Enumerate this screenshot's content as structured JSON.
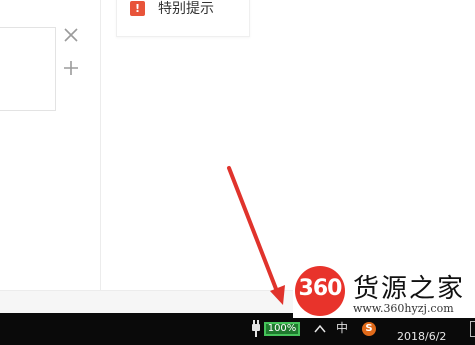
{
  "notice": {
    "badge": "!",
    "label": "特别提示",
    "badge_color": "#e8543a"
  },
  "panel": {
    "close_icon": "close-icon",
    "add_icon": "plus-icon"
  },
  "taskbar": {
    "battery_percent": "100%",
    "ime_label": "中",
    "sogou_label": "S",
    "date": "2018/6/2",
    "icons": [
      "power-plug-icon",
      "battery-icon",
      "chevron-up-icon",
      "ime-icon",
      "sogou-icon",
      "notification-icon"
    ]
  },
  "watermark": {
    "logo_text": "360",
    "title": "货源之家",
    "url": "www.360hyzj.com",
    "logo_color": "#e8332b"
  },
  "annotation": {
    "arrow_color": "#e0332c"
  }
}
